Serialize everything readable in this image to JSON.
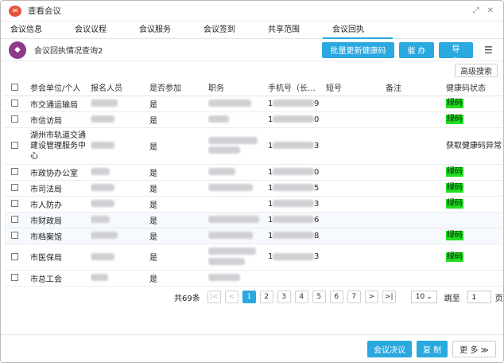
{
  "window": {
    "title": "查看会议"
  },
  "tabs": [
    {
      "label": "会议信息"
    },
    {
      "label": "会议议程"
    },
    {
      "label": "会议服务"
    },
    {
      "label": "会议签到"
    },
    {
      "label": "共享范围"
    },
    {
      "label": "会议回执",
      "active": true
    }
  ],
  "toolbar": {
    "label": "会议回执情况查询2",
    "batch_update_label": "批量更新健康码",
    "urge_label": "催 办",
    "export_label": "导 出"
  },
  "search": {
    "advanced_label": "高级搜索"
  },
  "table": {
    "headers": [
      "参会单位/个人",
      "报名人员",
      "是否参加",
      "职务",
      "手机号（长…",
      "短号",
      "备注",
      "健康码状态"
    ],
    "rows": [
      {
        "unit": "市交通运输局",
        "attend": "是",
        "phone_first": "1",
        "phone_last": "9",
        "status": "绿码"
      },
      {
        "unit": "市信访局",
        "attend": "是",
        "phone_first": "1",
        "phone_last": "0",
        "status": "绿码"
      },
      {
        "unit": "湖州市轨道交通建设管理服务中心",
        "attend": "是",
        "phone_first": "1",
        "phone_last": "3",
        "status": "获取健康码异常"
      },
      {
        "unit": "市政协办公室",
        "attend": "是",
        "phone_first": "1",
        "phone_last": "0",
        "status": "绿码"
      },
      {
        "unit": "市司法局",
        "attend": "是",
        "phone_first": "1",
        "phone_last": "5",
        "status": "绿码"
      },
      {
        "unit": "市人防办",
        "attend": "是",
        "phone_first": "1",
        "phone_last": "3",
        "status": "绿码"
      },
      {
        "unit": "市财政局",
        "attend": "是",
        "phone_first": "1",
        "phone_last": "6",
        "status": ""
      },
      {
        "unit": "市档案馆",
        "attend": "是",
        "phone_first": "1",
        "phone_last": "8",
        "status": "绿码"
      },
      {
        "unit": "市医保局",
        "attend": "是",
        "phone_first": "1",
        "phone_last": "3",
        "status": "绿码"
      },
      {
        "unit": "市总工会",
        "attend": "是",
        "phone_first": "",
        "phone_last": "",
        "status": ""
      }
    ]
  },
  "pagination": {
    "total_label": "共69条",
    "pages": [
      "1",
      "2",
      "3",
      "4",
      "5",
      "6",
      "7"
    ],
    "current_page": "1",
    "page_size": "10",
    "jump_label": "跳至",
    "jump_value": "1",
    "page_suffix": "页"
  },
  "footer": {
    "resolution_label": "会议决议",
    "copy_label": "复 制",
    "more_label": "更 多 ≫"
  },
  "colors": {
    "accent": "#2aa8e0",
    "green_code": "#22dd22",
    "app_logo": "#e8543b",
    "toolbar_icon": "#8d3a8a"
  }
}
